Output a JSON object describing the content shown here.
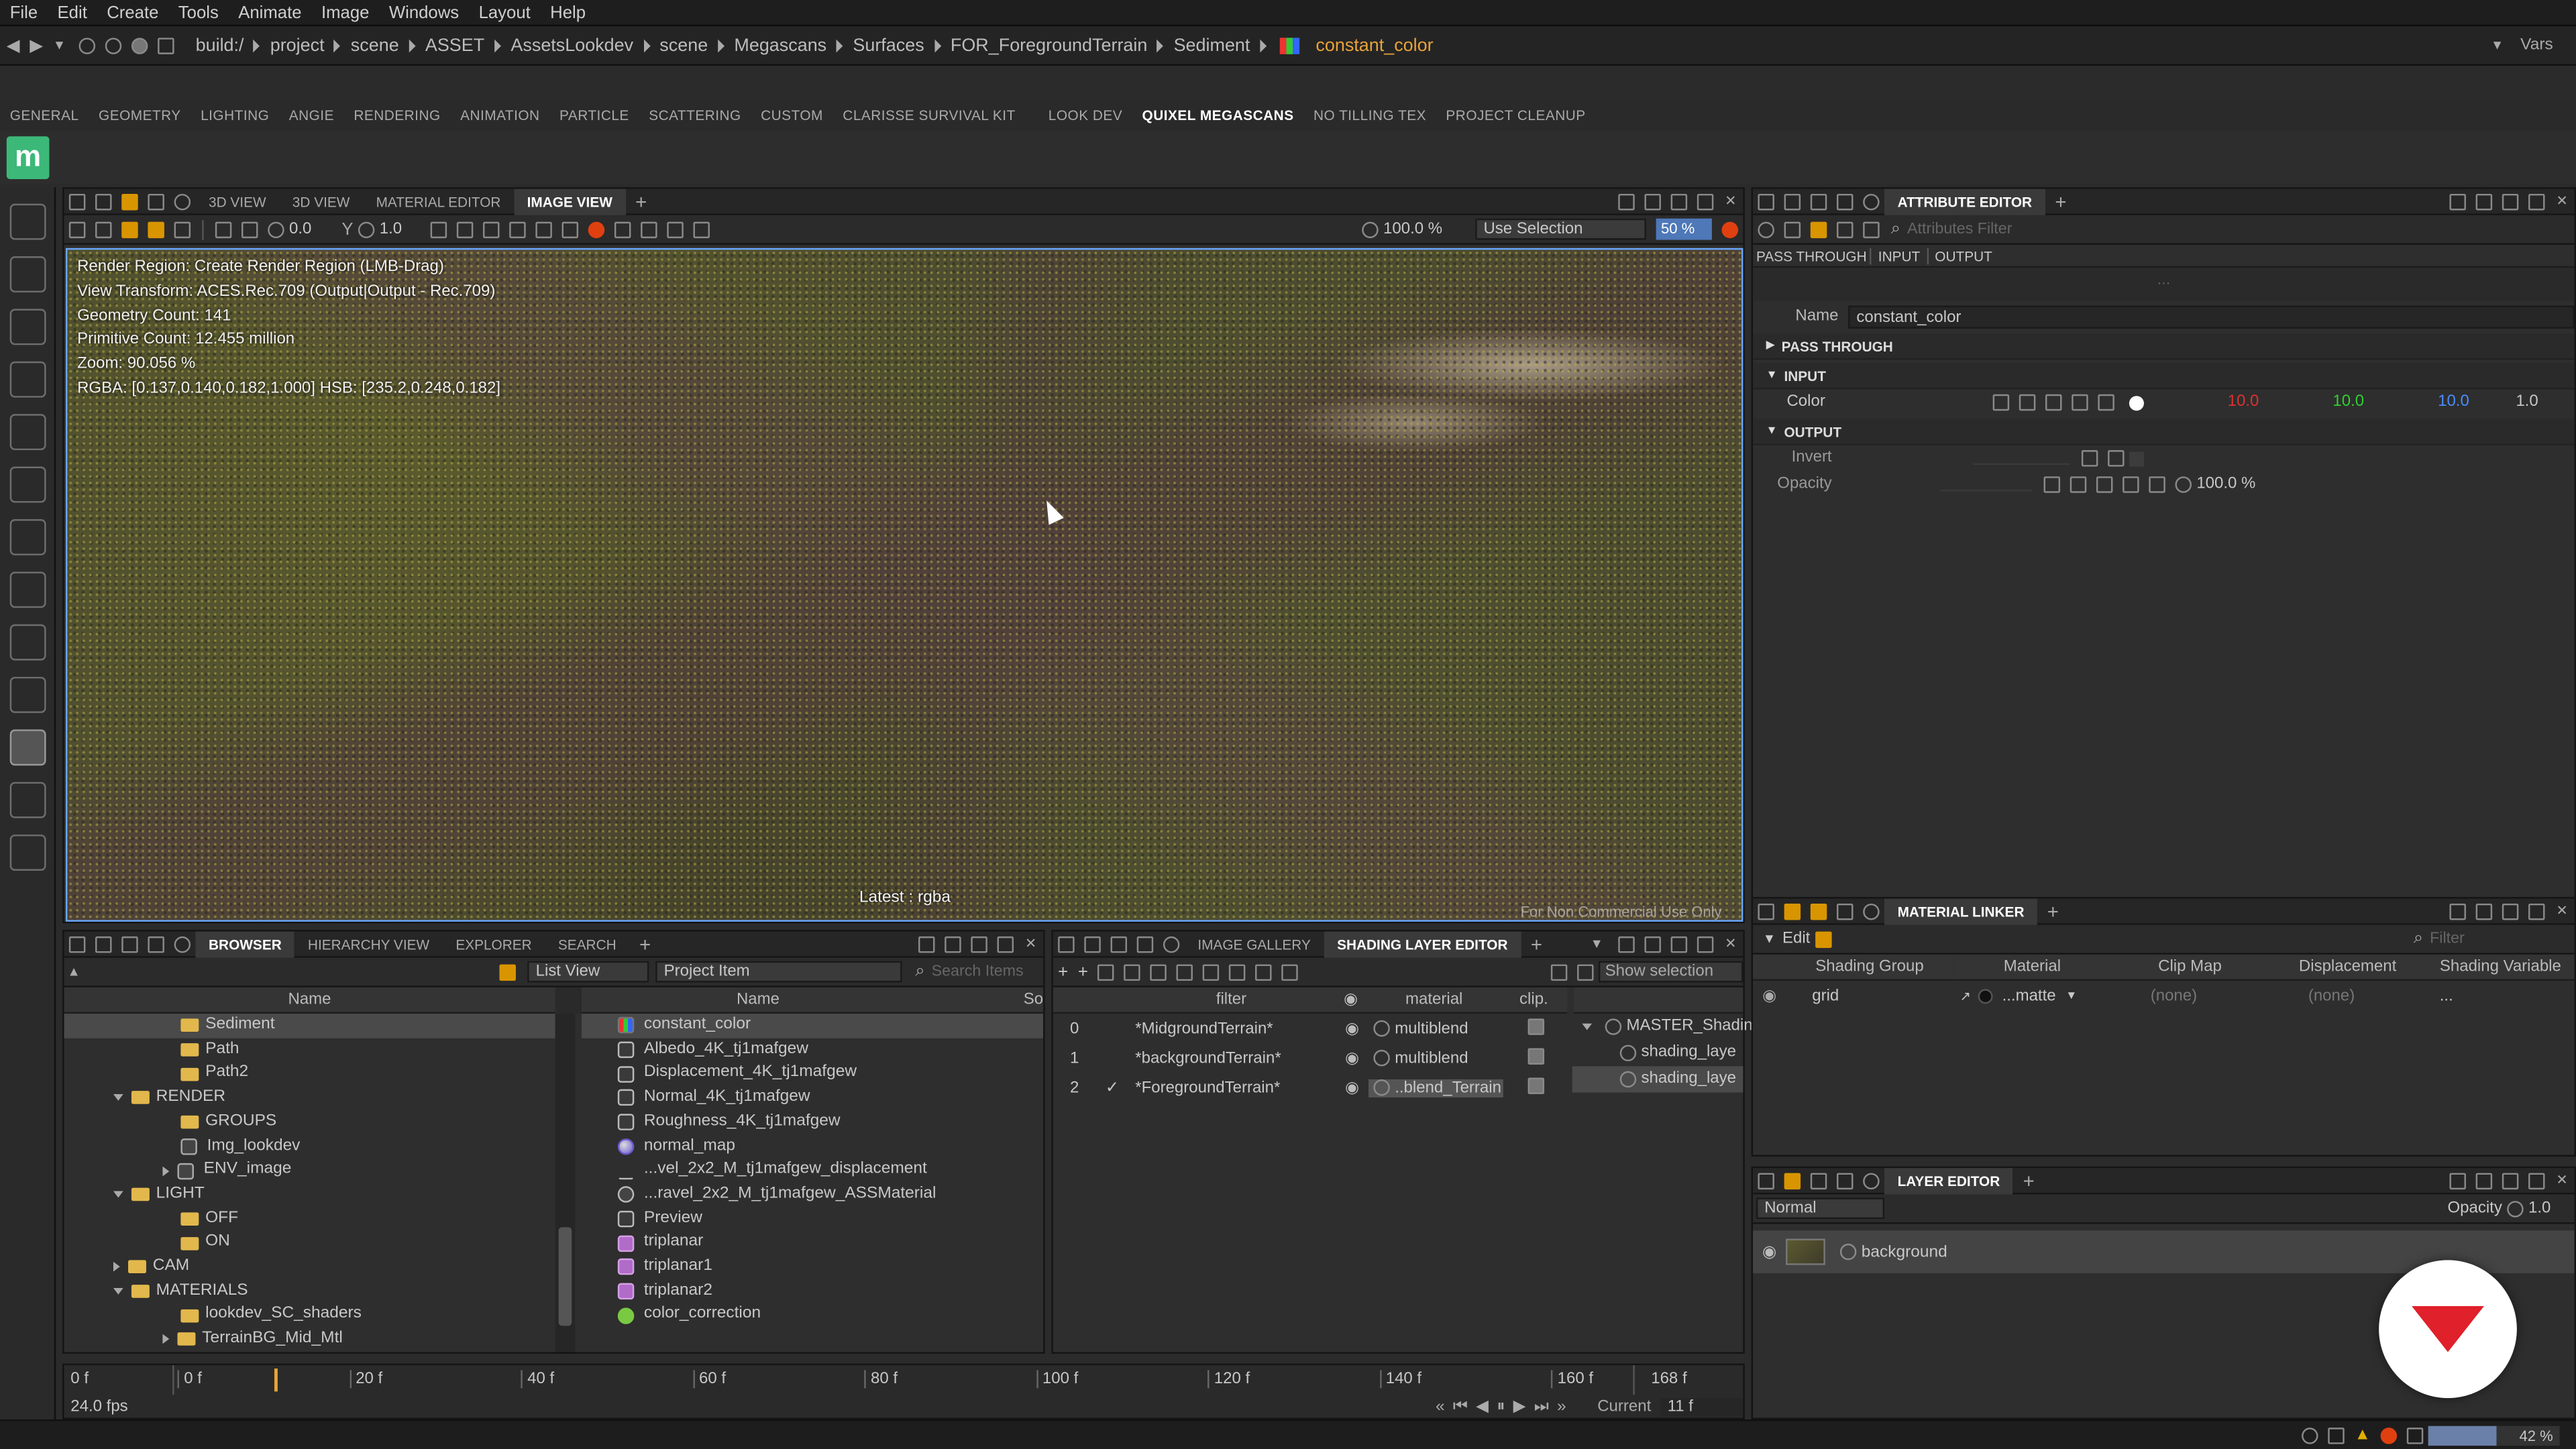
{
  "menu": [
    "File",
    "Edit",
    "Create",
    "Tools",
    "Animate",
    "Image",
    "Windows",
    "Layout",
    "Help"
  ],
  "path": [
    "build:/",
    "project",
    "scene",
    "ASSET",
    "AssetsLookdev",
    "scene",
    "Megascans",
    "Surfaces",
    "FOR_ForegroundTerrain",
    "Sediment"
  ],
  "path_leaf": "constant_color",
  "vars_label": "Vars",
  "shelf_tabs": [
    "GENERAL",
    "GEOMETRY",
    "LIGHTING",
    "ANGIE",
    "RENDERING",
    "ANIMATION",
    "PARTICLE",
    "SCATTERING",
    "CUSTOM",
    "CLARISSE SURVIVAL KIT",
    "LOOK DEV",
    "QUIXEL MEGASCANS",
    "NO TILLING TEX",
    "PROJECT CLEANUP"
  ],
  "logo_letter": "m",
  "imageview": {
    "tabs": [
      "3D VIEW",
      "3D VIEW",
      "MATERIAL EDITOR",
      "IMAGE VIEW"
    ],
    "exposure": "0.0",
    "gamma": "1.0",
    "zoom": "100.0 %",
    "selection_mode": "Use Selection",
    "opacity_pct": "50 %",
    "overlay": [
      "Render Region: Create Render Region (LMB-Drag)",
      "View Transform: ACES.Rec.709 (Output|Output - Rec.709)",
      "Geometry Count: 141",
      "Primitive Count: 12.455 million",
      "Zoom: 90.056 %",
      "RGBA: [0.137,0.140,0.182,1.000] HSB: [235.2,0.248,0.182]"
    ],
    "latest": "Latest : rgba",
    "watermark": "For Non Commercial Use Only"
  },
  "attr": {
    "title": "ATTRIBUTE EDITOR",
    "filter_placeholder": "Attributes Filter",
    "subtabs": [
      "PASS THROUGH",
      "INPUT",
      "OUTPUT"
    ],
    "name_label": "Name",
    "name_value": "constant_color",
    "sec_pass": "PASS THROUGH",
    "sec_input": "INPUT",
    "sec_output": "OUTPUT",
    "color_label": "Color",
    "color_r": "10.0",
    "color_g": "10.0",
    "color_b": "10.0",
    "color_a": "1.0",
    "invert_label": "Invert",
    "opacity_label": "Opacity",
    "opacity_value": "100.0 %"
  },
  "browser": {
    "tabs": [
      "BROWSER",
      "HIERARCHY VIEW",
      "EXPLORER",
      "SEARCH"
    ],
    "list_view": "List View",
    "project_item": "Project Item",
    "search_placeholder": "Search Items",
    "col_name": "Name",
    "col_name2": "Name",
    "col_so": "So",
    "tree": [
      {
        "label": "Sediment",
        "indent": 2,
        "kind": "folder",
        "sel": true
      },
      {
        "label": "Path",
        "indent": 2,
        "kind": "folder"
      },
      {
        "label": "Path2",
        "indent": 2,
        "kind": "folder"
      },
      {
        "label": "RENDER",
        "indent": 1,
        "kind": "folder",
        "exp": true
      },
      {
        "label": "GROUPS",
        "indent": 2,
        "kind": "folder"
      },
      {
        "label": "Img_lookdev",
        "indent": 2,
        "kind": "item"
      },
      {
        "label": "ENV_image",
        "indent": 2,
        "kind": "item",
        "col": true
      },
      {
        "label": "LIGHT",
        "indent": 1,
        "kind": "folder",
        "exp": true
      },
      {
        "label": "OFF",
        "indent": 2,
        "kind": "folder"
      },
      {
        "label": "ON",
        "indent": 2,
        "kind": "folder"
      },
      {
        "label": "CAM",
        "indent": 1,
        "kind": "folder",
        "col": true
      },
      {
        "label": "MATERIALS",
        "indent": 1,
        "kind": "folder",
        "exp": true
      },
      {
        "label": "lookdev_SC_shaders",
        "indent": 2,
        "kind": "folder"
      },
      {
        "label": "TerrainBG_Mid_Mtl",
        "indent": 2,
        "kind": "folder",
        "col": true
      }
    ],
    "items": [
      {
        "label": "constant_color",
        "icon": "rgb",
        "sel": true
      },
      {
        "label": "Albedo_4K_tj1mafgew",
        "icon": "tex"
      },
      {
        "label": "Displacement_4K_tj1mafgew",
        "icon": "tex"
      },
      {
        "label": "Normal_4K_tj1mafgew",
        "icon": "tex"
      },
      {
        "label": "Roughness_4K_tj1mafgew",
        "icon": "tex"
      },
      {
        "label": "normal_map",
        "icon": "sphere"
      },
      {
        "label": "...vel_2x2_M_tj1mafgew_displacement",
        "icon": "tri"
      },
      {
        "label": "...ravel_2x2_M_tj1mafgew_ASSMaterial",
        "icon": "mat"
      },
      {
        "label": "Preview",
        "icon": "tex"
      },
      {
        "label": "triplanar",
        "icon": "cube"
      },
      {
        "label": "triplanar1",
        "icon": "cube"
      },
      {
        "label": "triplanar2",
        "icon": "cube"
      },
      {
        "label": "color_correction",
        "icon": "green"
      }
    ]
  },
  "shading": {
    "tabs": [
      "IMAGE GALLERY",
      "SHADING LAYER EDITOR"
    ],
    "show_selection": "Show selection",
    "col_filter": "filter",
    "col_material": "material",
    "col_clip": "clip.",
    "rows": [
      {
        "idx": "0",
        "filter": "*MidgroundTerrain*",
        "material": "multiblend",
        "check": ""
      },
      {
        "idx": "1",
        "filter": "*backgroundTerrain*",
        "material": "multiblend",
        "check": ""
      },
      {
        "idx": "2",
        "filter": "*ForegroundTerrain*",
        "material": "..blend_Terrain",
        "check": "✓"
      }
    ],
    "tree": [
      "MASTER_Shadin",
      "shading_laye",
      "shading_laye"
    ]
  },
  "linker": {
    "title": "MATERIAL LINKER",
    "edit": "Edit",
    "filter_placeholder": "Filter",
    "cols": [
      "Shading Group",
      "Material",
      "Clip Map",
      "Displacement",
      "Shading Variable"
    ],
    "row": {
      "group": "grid",
      "material": "...matte",
      "clip": "(none)",
      "disp": "(none)",
      "var": "..."
    }
  },
  "layer": {
    "title": "LAYER EDITOR",
    "blend": "Normal",
    "opacity_label": "Opacity",
    "opacity_value": "1.0",
    "layer_name": "background"
  },
  "timeline": {
    "start": "0 f",
    "ticks": [
      "0 f",
      "20 f",
      "40 f",
      "60 f",
      "80 f",
      "100 f",
      "120 f",
      "140 f",
      "160 f"
    ],
    "end": "168 f",
    "fps": "24.0 fps",
    "current_label": "Current",
    "current_value": "11 f"
  },
  "status": {
    "zoom": "42 %"
  },
  "colors": {
    "accent": "#d99500",
    "selection": "#6aa8ff",
    "red": "#e0202a"
  }
}
